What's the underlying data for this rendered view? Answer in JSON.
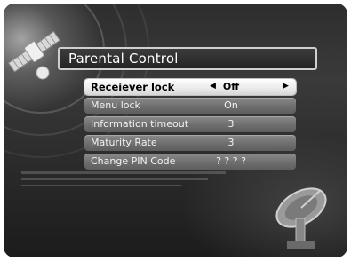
{
  "title": "Parental Control",
  "menu": {
    "items": [
      {
        "label": "Receiever lock",
        "value": "Off",
        "selected": true
      },
      {
        "label": "Menu lock",
        "value": "On",
        "selected": false
      },
      {
        "label": "Information timeout",
        "value": "3",
        "selected": false
      },
      {
        "label": "Maturity Rate",
        "value": "3",
        "selected": false
      },
      {
        "label": "Change PIN Code",
        "value": "? ? ? ?",
        "selected": false
      }
    ],
    "arrow_left": "◀",
    "arrow_right": "▶"
  },
  "icons": {
    "satellite": "satellite-icon",
    "dish": "satellite-dish-icon",
    "arrow_left": "triangle-left-icon",
    "arrow_right": "triangle-right-icon"
  },
  "colors": {
    "selected_row": "#ffffff",
    "row": "#7a7a7a",
    "background": "#2e2e2e",
    "title_border": "#cfcfcf"
  }
}
